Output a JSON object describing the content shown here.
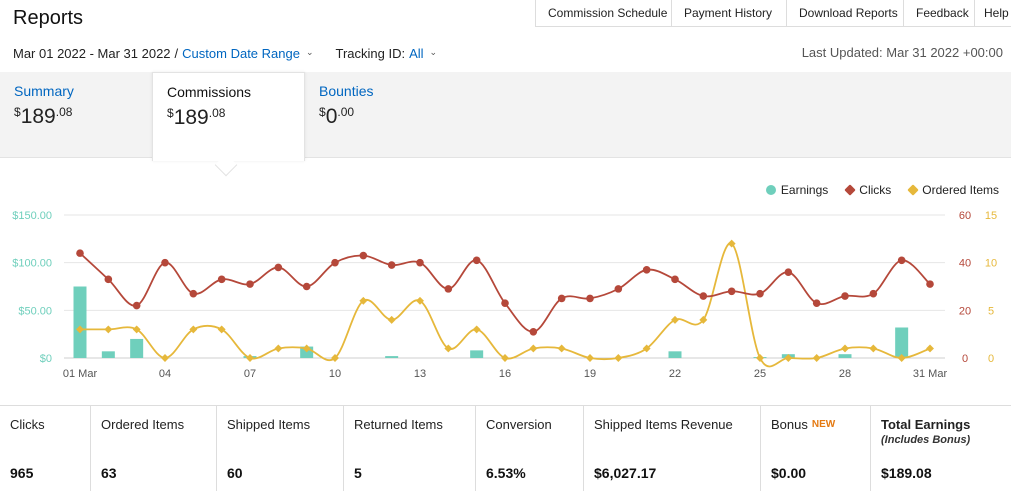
{
  "header": {
    "title": "Reports"
  },
  "toplinks": [
    "Commission Schedule",
    "Payment History",
    "Download Reports",
    "Feedback",
    "Help"
  ],
  "filters": {
    "date_range": "Mar 01 2022 - Mar 31 2022",
    "separator": "/",
    "custom_range": "Custom Date Range",
    "tracking_label": "Tracking ID:",
    "tracking_value": "All",
    "last_updated": "Last Updated: Mar 31 2022 +00:00"
  },
  "tabs": [
    {
      "label": "Summary",
      "currency": "$",
      "whole": "189",
      "cents": ".08"
    },
    {
      "label": "Commissions",
      "currency": "$",
      "whole": "189",
      "cents": ".08"
    },
    {
      "label": "Bounties",
      "currency": "$",
      "whole": "0",
      "cents": ".00"
    }
  ],
  "legend": {
    "earnings": "Earnings",
    "clicks": "Clicks",
    "ordered": "Ordered Items"
  },
  "colors": {
    "earnings": "#6fcfbc",
    "clicks": "#b5483a",
    "ordered": "#e6b83b",
    "axis_left": "#6fcfbc",
    "link": "#0066c0"
  },
  "chart_data": {
    "type": "line",
    "x_ticks": [
      "01 Mar",
      "04",
      "07",
      "10",
      "13",
      "16",
      "19",
      "22",
      "25",
      "28",
      "31 Mar"
    ],
    "x_days": [
      1,
      4,
      7,
      10,
      13,
      16,
      19,
      22,
      25,
      28,
      31
    ],
    "y_left_ticks": [
      "$0",
      "$50.00",
      "$100.00",
      "$150.00"
    ],
    "y_left_range": [
      0,
      150
    ],
    "y_clicks_ticks": [
      "0",
      "20",
      "40",
      "60"
    ],
    "y_clicks_range": [
      0,
      60
    ],
    "y_ordered_ticks": [
      "0",
      "5",
      "10",
      "15"
    ],
    "y_ordered_range": [
      0,
      15
    ],
    "series": [
      {
        "name": "Earnings",
        "type": "bar",
        "values": [
          75,
          7,
          20,
          0,
          0,
          0,
          2,
          0,
          12,
          0,
          0,
          2,
          0,
          0,
          8,
          0,
          0,
          0,
          0,
          0,
          0,
          7,
          0,
          0,
          1,
          4,
          0,
          4,
          0,
          32,
          0
        ]
      },
      {
        "name": "Clicks",
        "type": "line",
        "values": [
          44,
          33,
          22,
          40,
          27,
          33,
          31,
          38,
          30,
          40,
          43,
          39,
          40,
          29,
          41,
          23,
          11,
          25,
          25,
          29,
          37,
          33,
          26,
          28,
          27,
          36,
          23,
          26,
          27,
          41,
          31
        ]
      },
      {
        "name": "Ordered Items",
        "type": "line",
        "values": [
          3,
          3,
          3,
          0,
          3,
          3,
          0,
          1,
          1,
          0,
          6,
          4,
          6,
          1,
          3,
          0,
          1,
          1,
          0,
          0,
          1,
          4,
          4,
          12,
          0,
          0,
          0,
          1,
          1,
          0,
          1
        ]
      }
    ]
  },
  "stats": [
    {
      "label": "Clicks",
      "value": "965"
    },
    {
      "label": "Ordered Items",
      "value": "63"
    },
    {
      "label": "Shipped Items",
      "value": "60"
    },
    {
      "label": "Returned Items",
      "value": "5"
    },
    {
      "label": "Conversion",
      "value": "6.53%"
    },
    {
      "label": "Shipped Items Revenue",
      "value": "$6,027.17"
    },
    {
      "label": "Bonus",
      "badge": "NEW",
      "value": "$0.00"
    },
    {
      "label": "Total Earnings",
      "sub": "(Includes Bonus)",
      "value": "$189.08"
    }
  ]
}
